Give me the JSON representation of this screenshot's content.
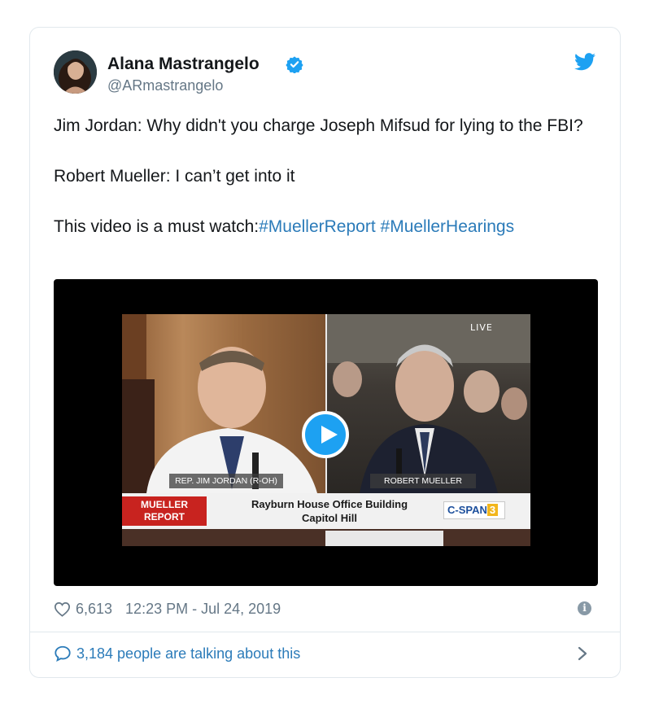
{
  "author": {
    "name": "Alana Mastrangelo",
    "handle": "@ARmastrangelo",
    "verified": true
  },
  "tweet": {
    "line1": "Jim Jordan: Why didn't you charge Joseph Mifsud for lying to the FBI?",
    "line2": "Robert Mueller: I can’t get into it",
    "line3_prefix": "This video is a must watch:",
    "hashtags": [
      "#MuellerReport",
      "#MuellerHearings"
    ]
  },
  "video": {
    "live_label": "LIVE",
    "left_lower_third": "REP. JIM JORDAN (R-OH)",
    "right_lower_third": "ROBERT MUELLER",
    "banner_red_line1": "MUELLER",
    "banner_red_line2": "REPORT",
    "banner_text_line1": "Rayburn House Office Building",
    "banner_text_line2": "Capitol Hill",
    "network_logo": "C-SPAN",
    "network_logo_suffix": "3"
  },
  "meta": {
    "likes": "6,613",
    "timestamp": "12:23 PM - Jul 24, 2019"
  },
  "footer": {
    "talking": "3,184 people are talking about this"
  },
  "colors": {
    "link": "#2b7bb9",
    "twitter_blue": "#1da1f2",
    "muted": "#657786",
    "border": "#e1e8ed"
  },
  "icons": {
    "bird": "twitter-bird-icon",
    "verified": "verified-badge-icon",
    "heart": "heart-icon",
    "info": "info-icon",
    "bubble": "speech-bubble-icon",
    "chevron": "chevron-right-icon",
    "play": "play-icon"
  }
}
